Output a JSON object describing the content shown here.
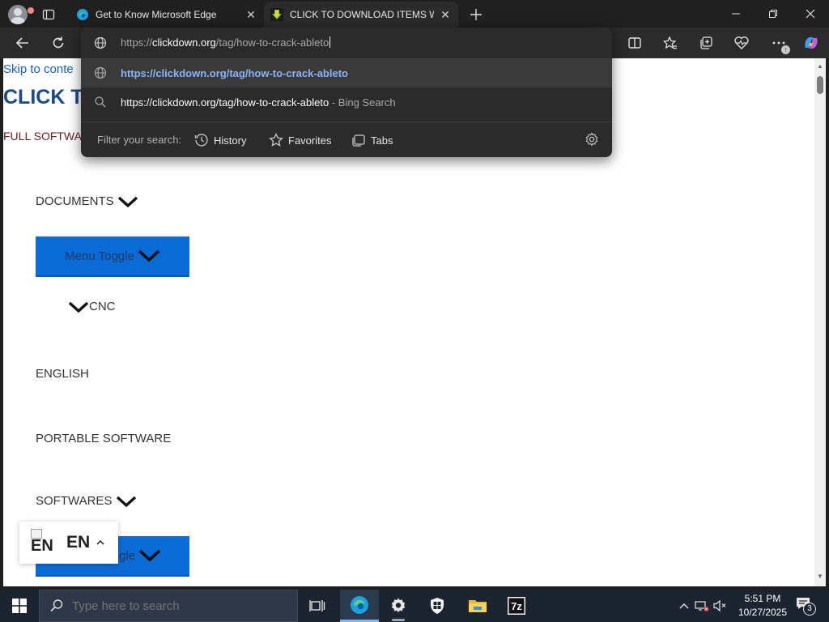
{
  "browser": {
    "tabs": [
      {
        "title": "Get to Know Microsoft Edge",
        "favicon": "edge-icon",
        "active": false
      },
      {
        "title": "CLICK TO DOWNLOAD ITEMS WH",
        "favicon": "download-arrow-icon",
        "active": true
      }
    ],
    "colors": {
      "accent_link": "#8ab4f8",
      "tab_strip": "#202020",
      "toolbar": "#2b2b2b"
    }
  },
  "omnibox": {
    "value": "https://clickdown.org/tag/how-to-crack-ableto",
    "value_scheme": "https://",
    "value_host": "clickdown.org",
    "value_path": "/tag/how-to-crack-ableto",
    "suggestions": [
      {
        "text": "https://clickdown.org/tag/how-to-crack-ableto",
        "suffix": "",
        "icon": "globe-icon"
      },
      {
        "text": "https://clickdown.org/tag/how-to-crack-ableto",
        "suffix": " - Bing Search",
        "icon": "search-icon"
      }
    ],
    "filter_label": "Filter your search:",
    "filters": [
      "History",
      "Favorites",
      "Tabs"
    ]
  },
  "page": {
    "skip_link": "Skip to conte",
    "site_title": "CLICK TO",
    "tagline": "FULL SOFTWA",
    "menu": {
      "documents": "DOCUMENTS",
      "toggle": "Menu Toggle",
      "cnc": "CNC",
      "english": "ENGLISH",
      "portable": "PORTABLE SOFTWARE",
      "softwares": "SOFTWARES",
      "toggle_2": "ggle"
    },
    "language_widget": {
      "flag_alt": "EN",
      "code": "EN"
    },
    "colors": {
      "toggle_bg": "#0b6bd6",
      "title": "#1c4a86"
    }
  },
  "taskbar": {
    "search_placeholder": "Type here to search",
    "time": "5:51 PM",
    "date": "10/27/2025",
    "notification_count": "3",
    "pinned": [
      "task-view-icon",
      "edge-icon",
      "settings-gear-icon",
      "windows-security-icon",
      "file-explorer-icon",
      "7zip-icon"
    ],
    "sevenzip_label": "7z"
  }
}
